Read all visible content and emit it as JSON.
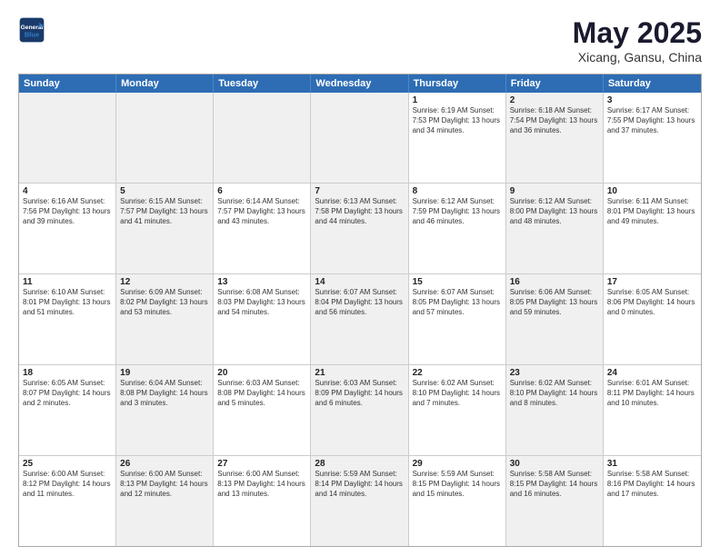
{
  "logo": {
    "line1": "General",
    "line2": "Blue"
  },
  "title": "May 2025",
  "location": "Xicang, Gansu, China",
  "weekdays": [
    "Sunday",
    "Monday",
    "Tuesday",
    "Wednesday",
    "Thursday",
    "Friday",
    "Saturday"
  ],
  "rows": [
    [
      {
        "day": "",
        "text": "",
        "shaded": true
      },
      {
        "day": "",
        "text": "",
        "shaded": true
      },
      {
        "day": "",
        "text": "",
        "shaded": true
      },
      {
        "day": "",
        "text": "",
        "shaded": true
      },
      {
        "day": "1",
        "text": "Sunrise: 6:19 AM\nSunset: 7:53 PM\nDaylight: 13 hours\nand 34 minutes."
      },
      {
        "day": "2",
        "text": "Sunrise: 6:18 AM\nSunset: 7:54 PM\nDaylight: 13 hours\nand 36 minutes.",
        "shaded": true
      },
      {
        "day": "3",
        "text": "Sunrise: 6:17 AM\nSunset: 7:55 PM\nDaylight: 13 hours\nand 37 minutes."
      }
    ],
    [
      {
        "day": "4",
        "text": "Sunrise: 6:16 AM\nSunset: 7:56 PM\nDaylight: 13 hours\nand 39 minutes."
      },
      {
        "day": "5",
        "text": "Sunrise: 6:15 AM\nSunset: 7:57 PM\nDaylight: 13 hours\nand 41 minutes.",
        "shaded": true
      },
      {
        "day": "6",
        "text": "Sunrise: 6:14 AM\nSunset: 7:57 PM\nDaylight: 13 hours\nand 43 minutes."
      },
      {
        "day": "7",
        "text": "Sunrise: 6:13 AM\nSunset: 7:58 PM\nDaylight: 13 hours\nand 44 minutes.",
        "shaded": true
      },
      {
        "day": "8",
        "text": "Sunrise: 6:12 AM\nSunset: 7:59 PM\nDaylight: 13 hours\nand 46 minutes."
      },
      {
        "day": "9",
        "text": "Sunrise: 6:12 AM\nSunset: 8:00 PM\nDaylight: 13 hours\nand 48 minutes.",
        "shaded": true
      },
      {
        "day": "10",
        "text": "Sunrise: 6:11 AM\nSunset: 8:01 PM\nDaylight: 13 hours\nand 49 minutes."
      }
    ],
    [
      {
        "day": "11",
        "text": "Sunrise: 6:10 AM\nSunset: 8:01 PM\nDaylight: 13 hours\nand 51 minutes."
      },
      {
        "day": "12",
        "text": "Sunrise: 6:09 AM\nSunset: 8:02 PM\nDaylight: 13 hours\nand 53 minutes.",
        "shaded": true
      },
      {
        "day": "13",
        "text": "Sunrise: 6:08 AM\nSunset: 8:03 PM\nDaylight: 13 hours\nand 54 minutes."
      },
      {
        "day": "14",
        "text": "Sunrise: 6:07 AM\nSunset: 8:04 PM\nDaylight: 13 hours\nand 56 minutes.",
        "shaded": true
      },
      {
        "day": "15",
        "text": "Sunrise: 6:07 AM\nSunset: 8:05 PM\nDaylight: 13 hours\nand 57 minutes."
      },
      {
        "day": "16",
        "text": "Sunrise: 6:06 AM\nSunset: 8:05 PM\nDaylight: 13 hours\nand 59 minutes.",
        "shaded": true
      },
      {
        "day": "17",
        "text": "Sunrise: 6:05 AM\nSunset: 8:06 PM\nDaylight: 14 hours\nand 0 minutes."
      }
    ],
    [
      {
        "day": "18",
        "text": "Sunrise: 6:05 AM\nSunset: 8:07 PM\nDaylight: 14 hours\nand 2 minutes."
      },
      {
        "day": "19",
        "text": "Sunrise: 6:04 AM\nSunset: 8:08 PM\nDaylight: 14 hours\nand 3 minutes.",
        "shaded": true
      },
      {
        "day": "20",
        "text": "Sunrise: 6:03 AM\nSunset: 8:08 PM\nDaylight: 14 hours\nand 5 minutes."
      },
      {
        "day": "21",
        "text": "Sunrise: 6:03 AM\nSunset: 8:09 PM\nDaylight: 14 hours\nand 6 minutes.",
        "shaded": true
      },
      {
        "day": "22",
        "text": "Sunrise: 6:02 AM\nSunset: 8:10 PM\nDaylight: 14 hours\nand 7 minutes."
      },
      {
        "day": "23",
        "text": "Sunrise: 6:02 AM\nSunset: 8:10 PM\nDaylight: 14 hours\nand 8 minutes.",
        "shaded": true
      },
      {
        "day": "24",
        "text": "Sunrise: 6:01 AM\nSunset: 8:11 PM\nDaylight: 14 hours\nand 10 minutes."
      }
    ],
    [
      {
        "day": "25",
        "text": "Sunrise: 6:00 AM\nSunset: 8:12 PM\nDaylight: 14 hours\nand 11 minutes."
      },
      {
        "day": "26",
        "text": "Sunrise: 6:00 AM\nSunset: 8:13 PM\nDaylight: 14 hours\nand 12 minutes.",
        "shaded": true
      },
      {
        "day": "27",
        "text": "Sunrise: 6:00 AM\nSunset: 8:13 PM\nDaylight: 14 hours\nand 13 minutes."
      },
      {
        "day": "28",
        "text": "Sunrise: 5:59 AM\nSunset: 8:14 PM\nDaylight: 14 hours\nand 14 minutes.",
        "shaded": true
      },
      {
        "day": "29",
        "text": "Sunrise: 5:59 AM\nSunset: 8:15 PM\nDaylight: 14 hours\nand 15 minutes."
      },
      {
        "day": "30",
        "text": "Sunrise: 5:58 AM\nSunset: 8:15 PM\nDaylight: 14 hours\nand 16 minutes.",
        "shaded": true
      },
      {
        "day": "31",
        "text": "Sunrise: 5:58 AM\nSunset: 8:16 PM\nDaylight: 14 hours\nand 17 minutes."
      }
    ]
  ]
}
